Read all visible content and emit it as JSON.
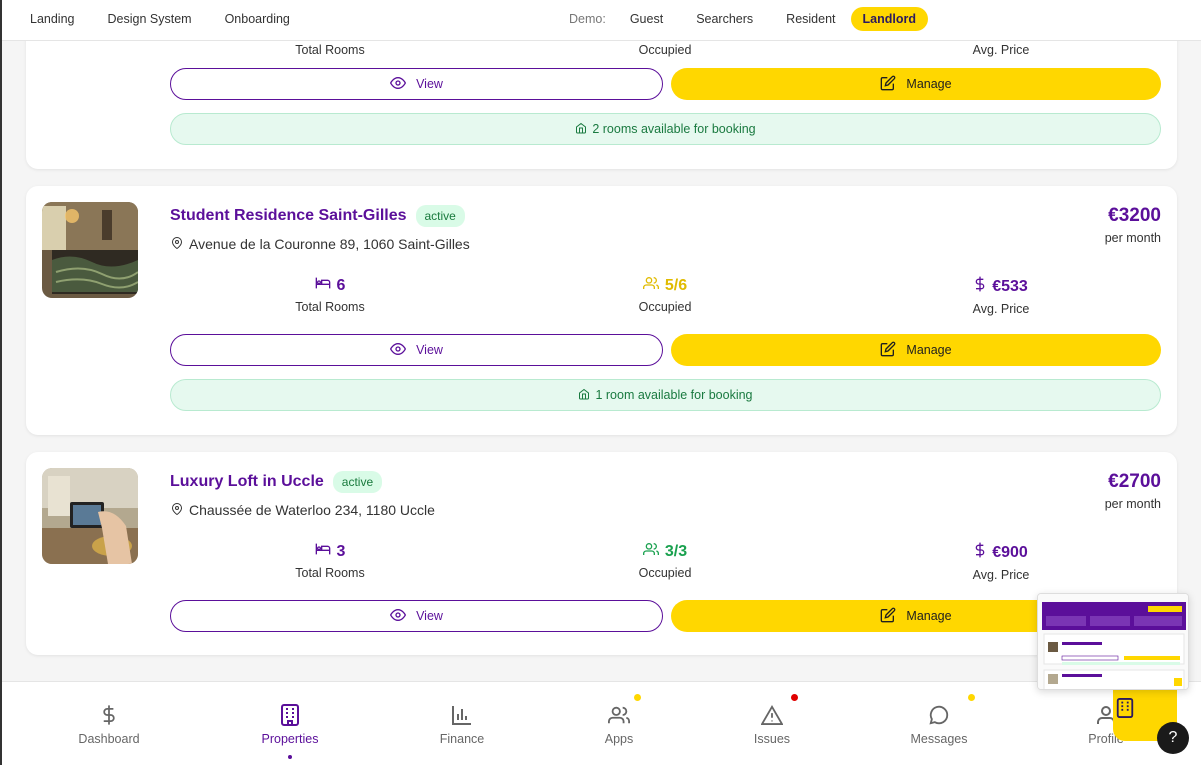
{
  "topnav": {
    "links": [
      "Landing",
      "Design System",
      "Onboarding"
    ],
    "demo_label": "Demo:",
    "demo_options": [
      "Guest",
      "Searchers",
      "Resident",
      "Landlord"
    ]
  },
  "card0": {
    "stats": [
      {
        "label": "Total Rooms"
      },
      {
        "label": "Occupied"
      },
      {
        "label": "Avg. Price"
      }
    ],
    "view_label": "View",
    "manage_label": "Manage",
    "availability": "2 rooms available for booking"
  },
  "properties": [
    {
      "name": "Student Residence Saint-Gilles",
      "status": "active",
      "address": "Avenue de la Couronne 89, 1060 Saint-Gilles",
      "price": "€3200",
      "period": "per month",
      "rooms": "6",
      "rooms_label": "Total Rooms",
      "occupied": "5/6",
      "occupied_label": "Occupied",
      "avg_price": "€533",
      "avg_label": "Avg. Price",
      "view_label": "View",
      "manage_label": "Manage",
      "availability": "1 room available for booking"
    },
    {
      "name": "Luxury Loft in Uccle",
      "status": "active",
      "address": "Chaussée de Waterloo 234, 1180 Uccle",
      "price": "€2700",
      "period": "per month",
      "rooms": "3",
      "rooms_label": "Total Rooms",
      "occupied": "3/3",
      "occupied_label": "Occupied",
      "avg_price": "€900",
      "avg_label": "Avg. Price",
      "view_label": "View",
      "manage_label": "Manage"
    }
  ],
  "bottomnav": {
    "items": [
      {
        "label": "Dashboard",
        "icon": "dollar-icon"
      },
      {
        "label": "Properties",
        "icon": "building-icon"
      },
      {
        "label": "Finance",
        "icon": "bar-chart-icon"
      },
      {
        "label": "Apps",
        "icon": "users-icon"
      },
      {
        "label": "Issues",
        "icon": "warning-icon"
      },
      {
        "label": "Messages",
        "icon": "chat-icon"
      },
      {
        "label": "Profile",
        "icon": "user-icon"
      }
    ]
  },
  "colors": {
    "brand": "#5b0f9a",
    "accent": "#ffd700",
    "success": "#1aa14f",
    "badge_yellow": "#ffd700",
    "badge_red": "#e00000"
  },
  "help_label": "?"
}
